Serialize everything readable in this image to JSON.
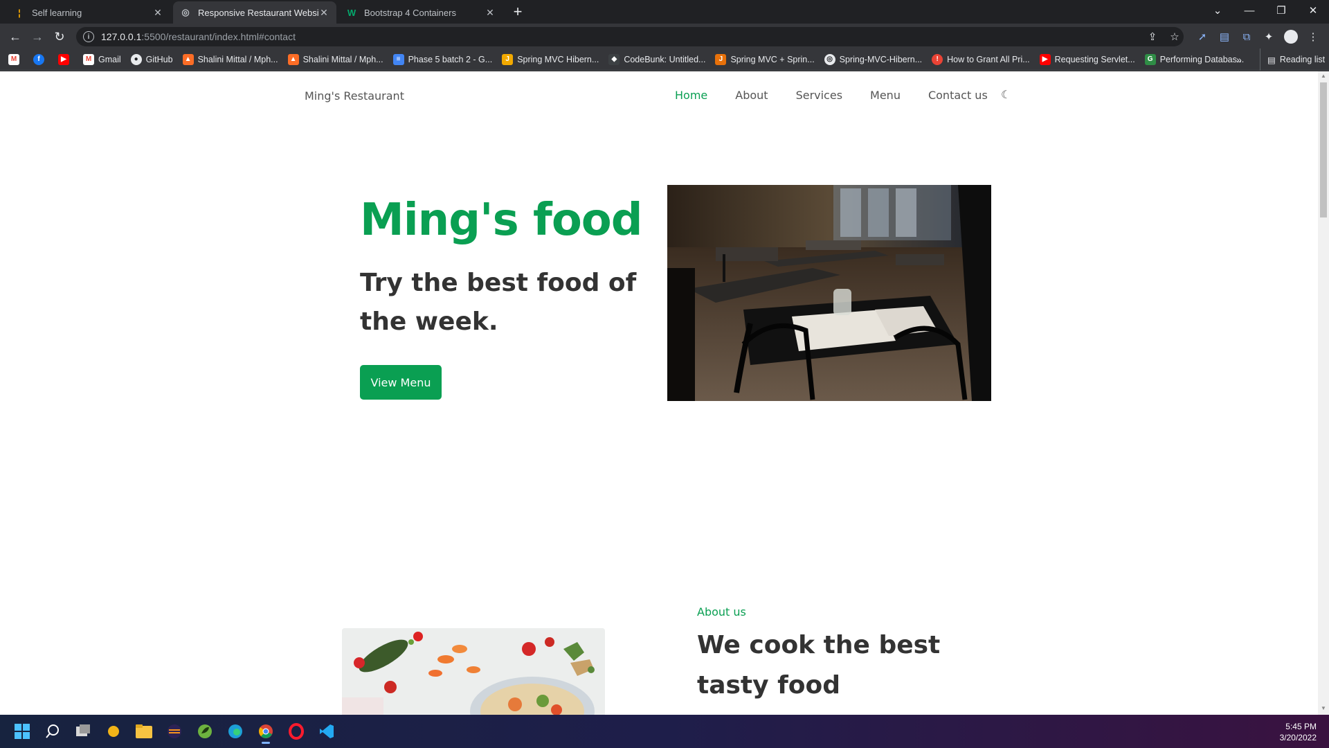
{
  "browser": {
    "tabs": [
      {
        "title": "Self learning",
        "active": false
      },
      {
        "title": "Responsive Restaurant Website",
        "active": true
      },
      {
        "title": "Bootstrap 4 Containers",
        "active": false
      }
    ],
    "url": {
      "host": "127.0.0.1",
      "path": ":5500/restaurant/index.html#contact"
    },
    "bookmarks": [
      {
        "label": "Gmail",
        "icon": "gmail-icon",
        "color": "#ea4335"
      },
      {
        "label": "GitHub",
        "icon": "github-icon",
        "color": "#ffffff"
      },
      {
        "label": "Shalini Mittal / Mph...",
        "icon": "gitlab-icon",
        "color": "#fc6d26"
      },
      {
        "label": "Shalini Mittal / Mph...",
        "icon": "gitlab-icon",
        "color": "#fc6d26"
      },
      {
        "label": "Phase 5 batch 2 - G...",
        "icon": "docs-icon",
        "color": "#4285f4"
      },
      {
        "label": "Spring MVC Hibern...",
        "icon": "bookmark-j-icon",
        "color": "#f2a900"
      },
      {
        "label": "CodeBunk: Untitled...",
        "icon": "codebunk-icon",
        "color": "#5f6368"
      },
      {
        "label": "Spring MVC + Sprin...",
        "icon": "spring-icon",
        "color": "#e8710a"
      },
      {
        "label": "Spring-MVC-Hibern...",
        "icon": "globe-icon",
        "color": "#e8eaed"
      },
      {
        "label": "How to Grant All Pri...",
        "icon": "info-circle-icon",
        "color": "#ea4335"
      },
      {
        "label": "Requesting Servlet...",
        "icon": "youtube-icon",
        "color": "#ff0000"
      },
      {
        "label": "Performing Databas...",
        "icon": "gfg-icon",
        "color": "#2f8d46"
      }
    ],
    "reading_list": "Reading list"
  },
  "site": {
    "brand": "Ming's Restaurant",
    "nav": [
      "Home",
      "About",
      "Services",
      "Menu",
      "Contact us"
    ],
    "active_nav": "Home",
    "accent": "#0a9f52",
    "hero": {
      "title": "Ming's food",
      "subtitle": "Try the best food of the week.",
      "button": "View Menu"
    },
    "about": {
      "label": "About us",
      "title": "We cook the best tasty food"
    }
  },
  "taskbar": {
    "time": "5:45 PM",
    "date": "3/20/2022"
  }
}
